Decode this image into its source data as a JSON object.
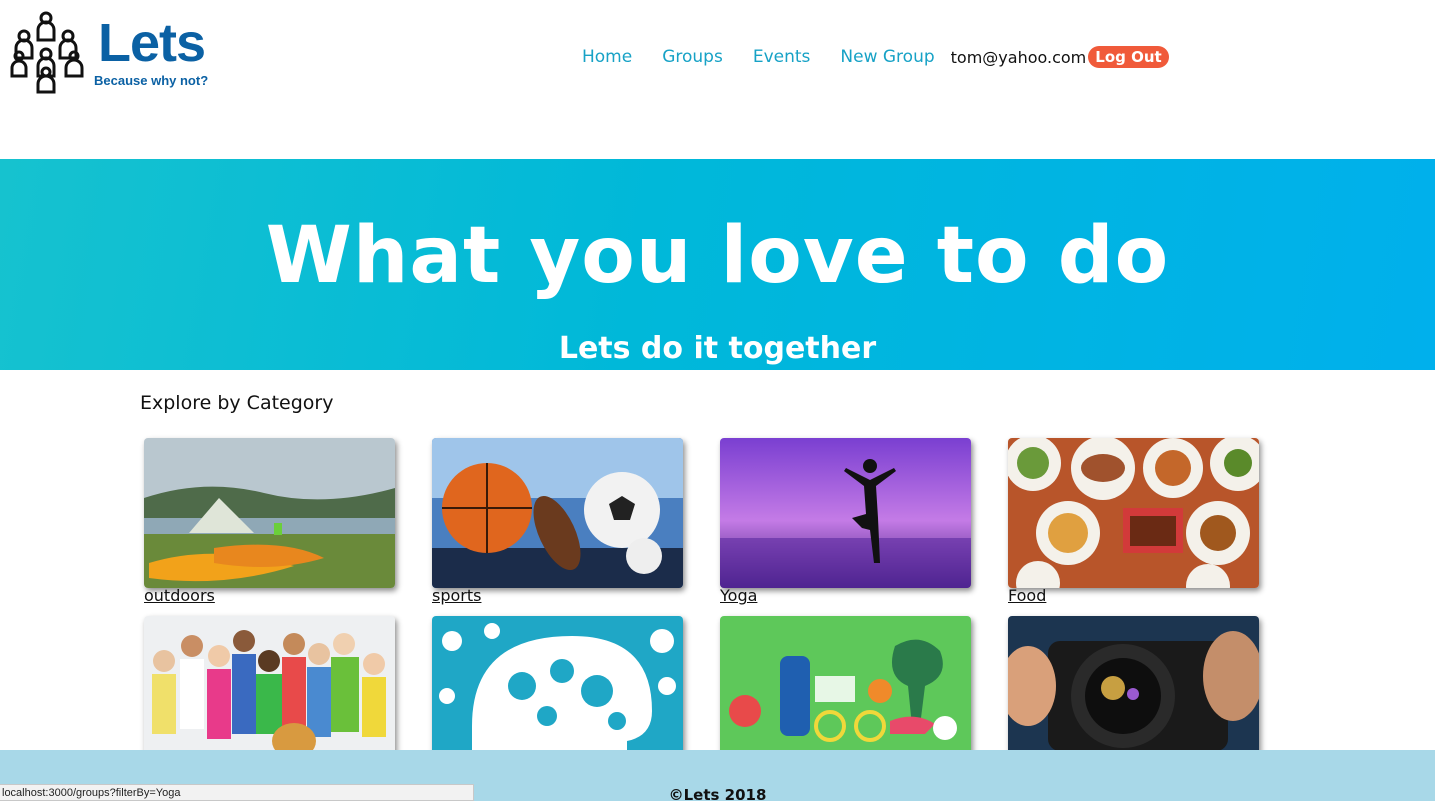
{
  "header": {
    "logo_title": "Lets",
    "logo_tagline": "Because why not?",
    "nav": [
      "Home",
      "Groups",
      "Events",
      "New Group"
    ],
    "user_email": "tom@yahoo.com",
    "logout_label": "Log Out"
  },
  "hero": {
    "title": "What you love to do",
    "subtitle": "Lets do it together"
  },
  "explore": {
    "title": "Explore by Category",
    "categories": [
      {
        "label": "outdoors",
        "icon": "camping-photo"
      },
      {
        "label": "sports",
        "icon": "sports-balls-photo"
      },
      {
        "label": "Yoga",
        "icon": "yoga-silhouette-photo"
      },
      {
        "label": "Food",
        "icon": "food-platters-photo"
      },
      {
        "label": "",
        "icon": "group-of-people-photo"
      },
      {
        "label": "",
        "icon": "brain-science-photo"
      },
      {
        "label": "",
        "icon": "fitness-illustration"
      },
      {
        "label": "",
        "icon": "camera-photographer-photo"
      }
    ]
  },
  "footer": {
    "text": "©Lets 2018"
  },
  "status_bar": {
    "url": "localhost:3000/groups?filterBy=Yoga"
  },
  "colors": {
    "brand": "#0b61a4",
    "nav_link": "#17a2c6",
    "logout": "#f05a3a",
    "hero_gradient_start": "#16c2cf",
    "hero_gradient_end": "#00b0ec",
    "footer_bg": "#a8d8e8"
  }
}
